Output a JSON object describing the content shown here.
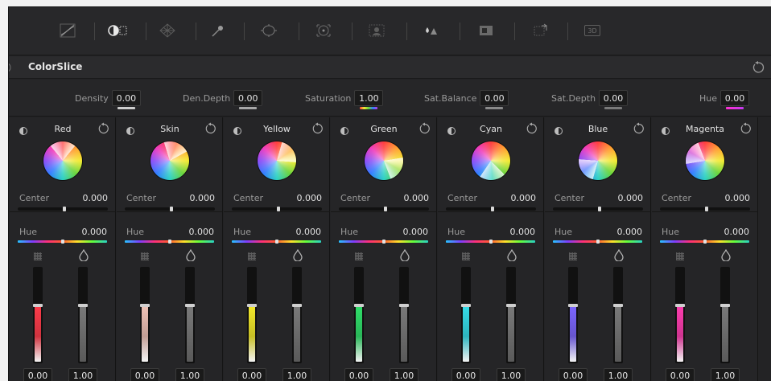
{
  "panel": {
    "title": "ColorSlice"
  },
  "toolbar": {
    "icons": [
      "curves-icon",
      "colorslice-icon",
      "color-warper-icon",
      "qualifier-eyedropper-icon",
      "window-icon",
      "tracker-icon",
      "magic-mask-icon",
      "blur-icon",
      "key-icon",
      "sizing-icon",
      "3d-icon"
    ],
    "icon_3d_label": "3D"
  },
  "params": [
    {
      "label": "Density",
      "value": "0.00",
      "accent": "#d8d8d8"
    },
    {
      "label": "Den.Depth",
      "value": "0.00",
      "accent": "#b8b8b8"
    },
    {
      "label": "Saturation",
      "value": "1.00",
      "accent": "#c43af0"
    },
    {
      "label": "Sat.Balance",
      "value": "0.00",
      "accent": "#9a9a9a"
    },
    {
      "label": "Sat.Depth",
      "value": "0.00",
      "accent": "#8a8a8a"
    },
    {
      "label": "Hue",
      "value": "0.00",
      "accent": "#ff2fd0"
    }
  ],
  "columns": [
    {
      "name": "Red",
      "color": "#ff3b4a",
      "center_label": "Center",
      "center_value": "0.000",
      "hue_label": "Hue",
      "hue_value": "0.000",
      "sat_value": "0.00",
      "den_value": "1.00",
      "fill_level": 0.6
    },
    {
      "name": "Skin",
      "color": "#efc2b6",
      "center_label": "Center",
      "center_value": "0.000",
      "hue_label": "Hue",
      "hue_value": "0.000",
      "sat_value": "0.00",
      "den_value": "1.00",
      "fill_level": 0.6
    },
    {
      "name": "Yellow",
      "color": "#f4ea2a",
      "center_label": "Center",
      "center_value": "0.000",
      "hue_label": "Hue",
      "hue_value": "0.000",
      "sat_value": "0.00",
      "den_value": "1.00",
      "fill_level": 0.6
    },
    {
      "name": "Green",
      "color": "#2fe06a",
      "center_label": "Center",
      "center_value": "0.000",
      "hue_label": "Hue",
      "hue_value": "0.000",
      "sat_value": "0.00",
      "den_value": "1.00",
      "fill_level": 0.6
    },
    {
      "name": "Cyan",
      "color": "#35dde9",
      "center_label": "Center",
      "center_value": "0.000",
      "hue_label": "Hue",
      "hue_value": "0.000",
      "sat_value": "0.00",
      "den_value": "1.00",
      "fill_level": 0.6
    },
    {
      "name": "Blue",
      "color": "#7c66ff",
      "center_label": "Center",
      "center_value": "0.000",
      "hue_label": "Hue",
      "hue_value": "0.000",
      "sat_value": "0.00",
      "den_value": "1.00",
      "fill_level": 0.6
    },
    {
      "name": "Magenta",
      "color": "#ff3db0",
      "center_label": "Center",
      "center_value": "0.000",
      "hue_label": "Hue",
      "hue_value": "0.000",
      "sat_value": "0.00",
      "den_value": "1.00",
      "fill_level": 0.6
    }
  ]
}
